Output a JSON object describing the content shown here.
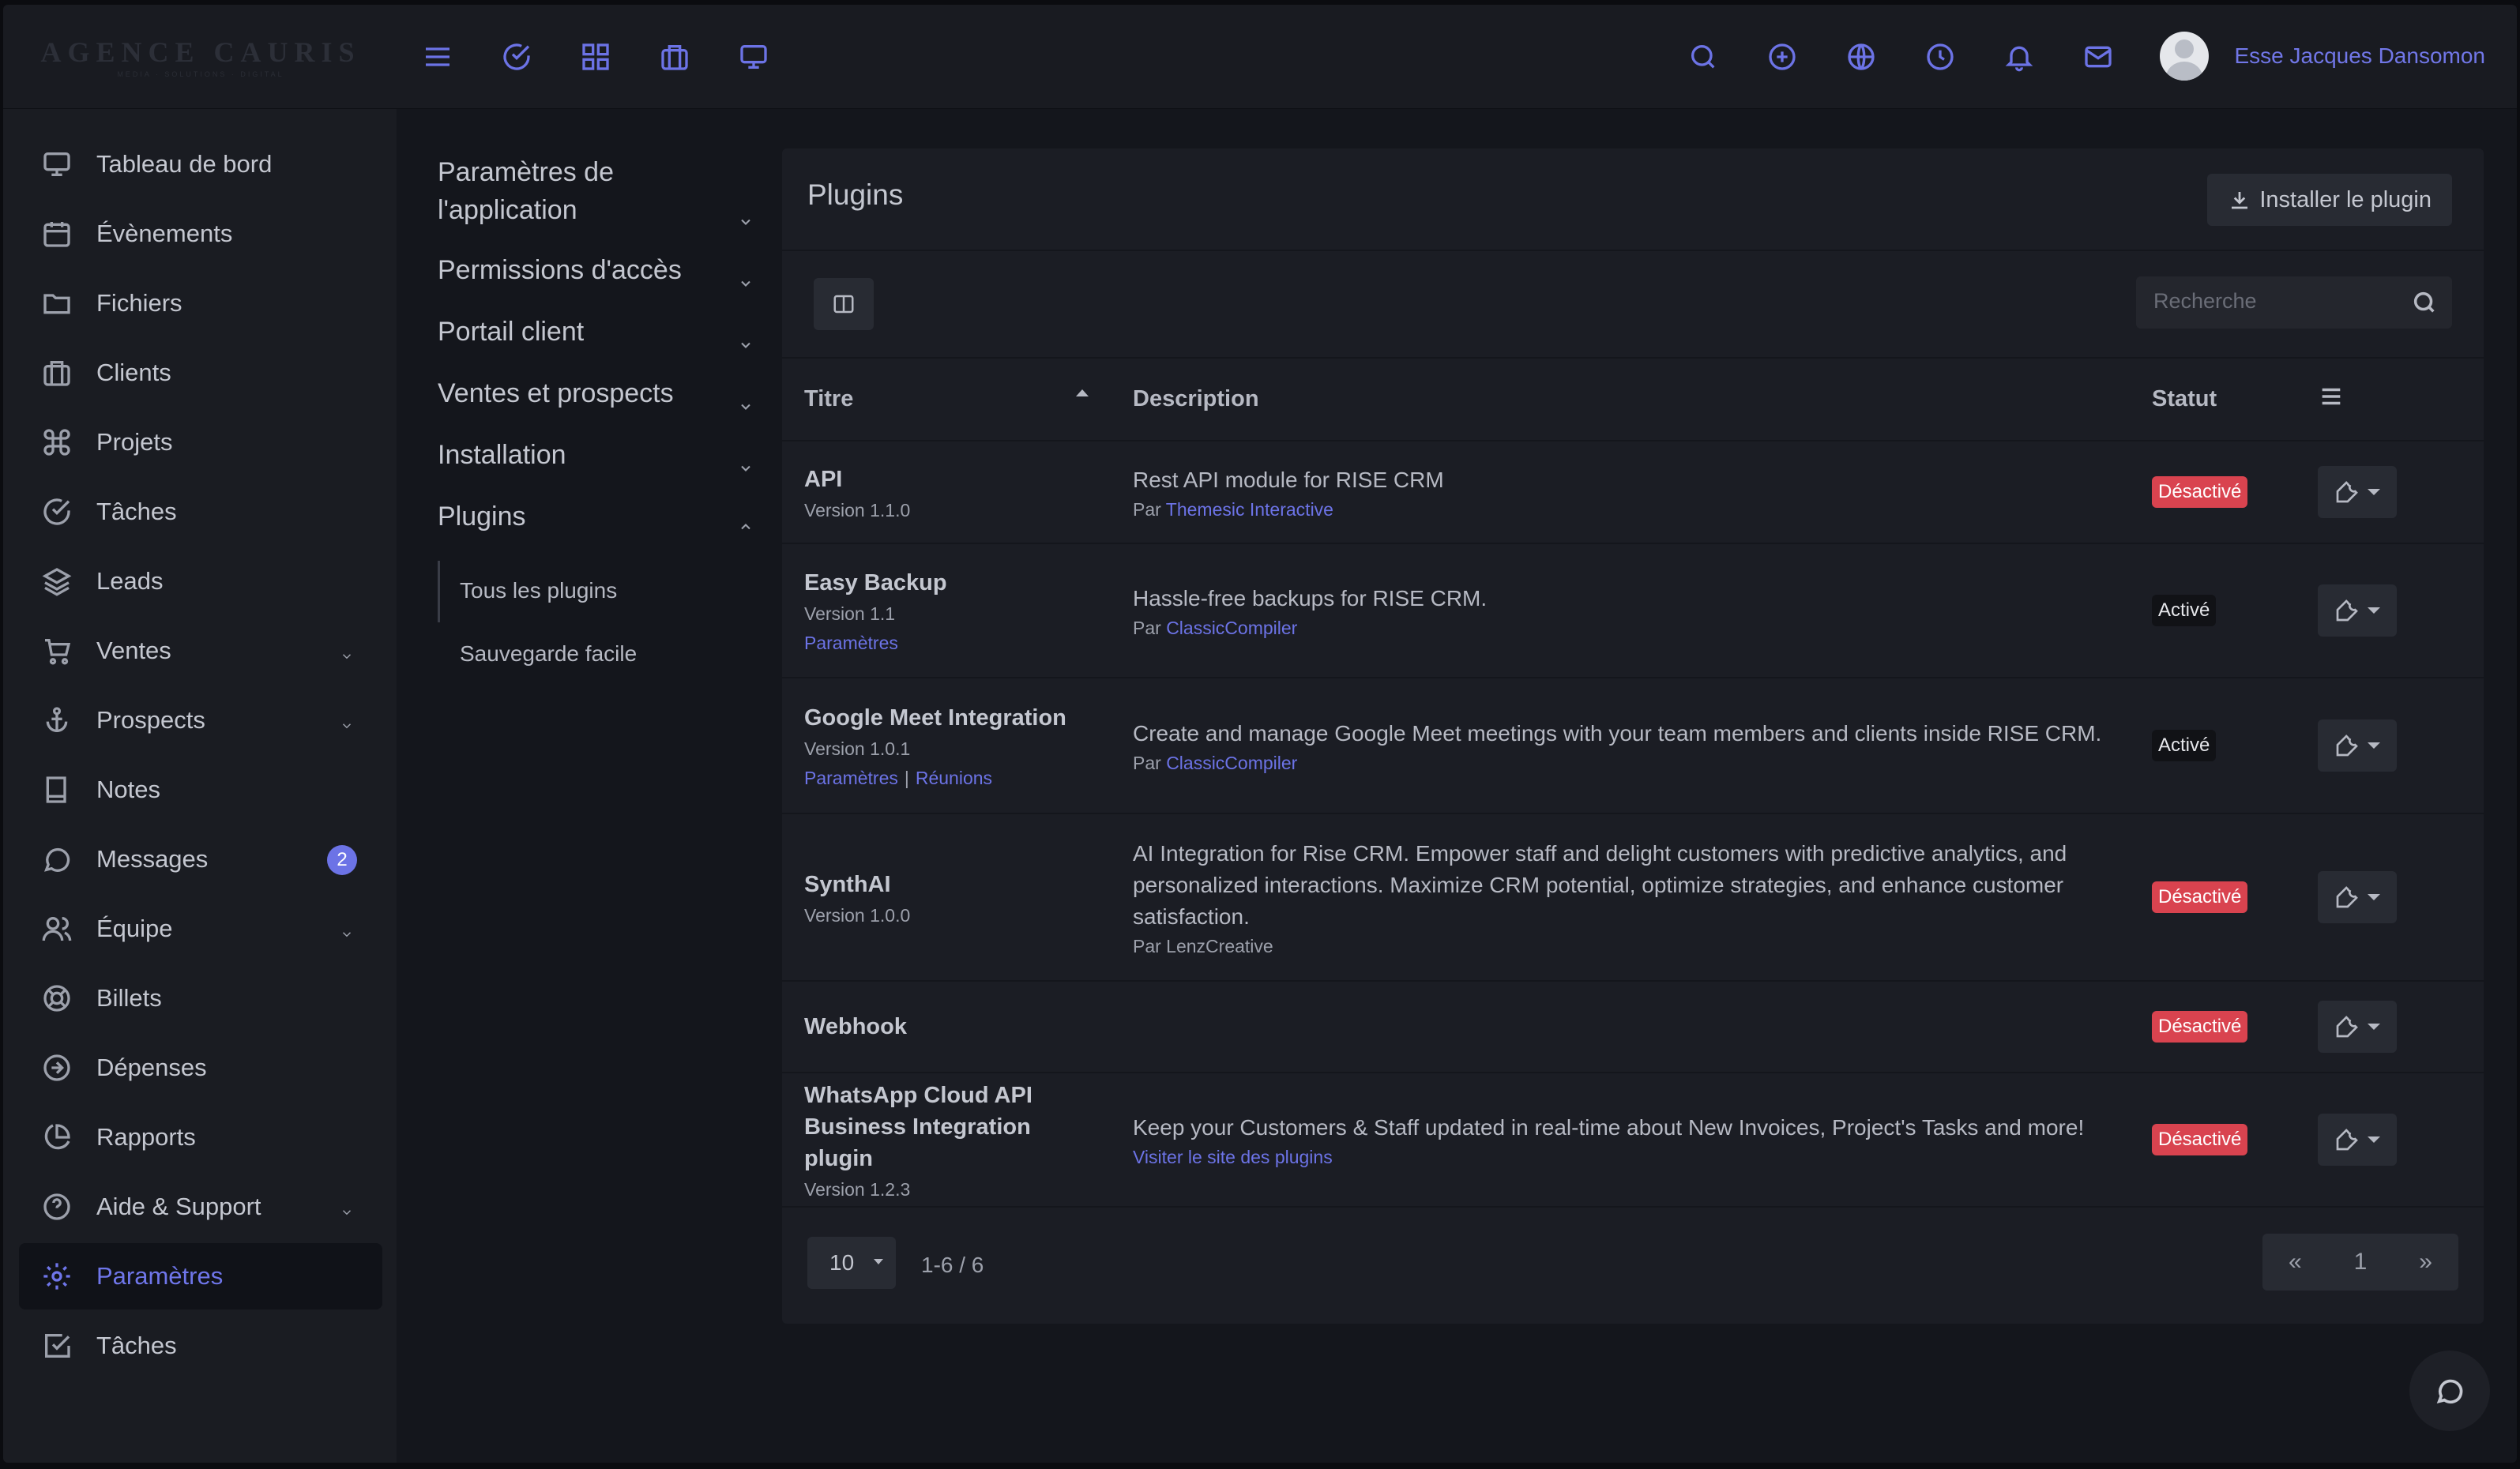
{
  "brand": {
    "name": "AGENCE CAURIS",
    "tagline": "MEDIA · SOLUTIONS · DIGITAL"
  },
  "topbar": {
    "left_icons": [
      "menu-icon",
      "check-circle-icon",
      "grid-icon",
      "briefcase-icon",
      "monitor-icon"
    ],
    "right_icons": [
      "search-icon",
      "plus-circle-icon",
      "globe-icon",
      "clock-icon",
      "bell-icon",
      "mail-icon"
    ],
    "user_name": "Esse Jacques Dansomon"
  },
  "sidebar": {
    "items": [
      {
        "label": "Tableau de bord",
        "icon": "monitor-icon"
      },
      {
        "label": "Évènements",
        "icon": "calendar-icon"
      },
      {
        "label": "Fichiers",
        "icon": "folder-icon"
      },
      {
        "label": "Clients",
        "icon": "briefcase-icon"
      },
      {
        "label": "Projets",
        "icon": "command-icon"
      },
      {
        "label": "Tâches",
        "icon": "check-circle-icon"
      },
      {
        "label": "Leads",
        "icon": "layers-icon"
      },
      {
        "label": "Ventes",
        "icon": "cart-icon",
        "expandable": true
      },
      {
        "label": "Prospects",
        "icon": "anchor-icon",
        "expandable": true
      },
      {
        "label": "Notes",
        "icon": "book-icon"
      },
      {
        "label": "Messages",
        "icon": "message-icon",
        "badge": "2"
      },
      {
        "label": "Équipe",
        "icon": "users-icon",
        "expandable": true
      },
      {
        "label": "Billets",
        "icon": "lifebuoy-icon"
      },
      {
        "label": "Dépenses",
        "icon": "arrow-circle-icon"
      },
      {
        "label": "Rapports",
        "icon": "pie-chart-icon"
      },
      {
        "label": "Aide & Support",
        "icon": "help-circle-icon",
        "expandable": true
      },
      {
        "label": "Paramètres",
        "icon": "gear-icon",
        "active": true
      },
      {
        "label": "Tâches",
        "icon": "check-square-icon"
      }
    ]
  },
  "settings_menu": {
    "items": [
      {
        "label_line1": "Paramètres de",
        "label_line2": "l'application"
      },
      {
        "label": "Permissions d'accès"
      },
      {
        "label": "Portail client"
      },
      {
        "label": "Ventes et prospects"
      },
      {
        "label": "Installation"
      },
      {
        "label": "Plugins",
        "expanded": true
      }
    ],
    "plugin_children": [
      "Tous les plugins",
      "Sauvegarde facile"
    ]
  },
  "panel": {
    "title": "Plugins",
    "install_label": "Installer le plugin",
    "search_placeholder": "Recherche",
    "columns": {
      "title": "Titre",
      "description": "Description",
      "status": "Statut"
    }
  },
  "plugins": [
    {
      "name": "API",
      "version": "Version 1.1.0",
      "desc": "Rest API module for RISE CRM",
      "by_prefix": "Par",
      "author": "Themesic Interactive",
      "status": "Désactivé"
    },
    {
      "name": "Easy Backup",
      "version": "Version 1.1",
      "links": [
        "Paramètres"
      ],
      "desc": "Hassle-free backups for RISE CRM.",
      "by_prefix": "Par",
      "author": "ClassicCompiler",
      "status": "Activé"
    },
    {
      "name": "Google Meet Integration",
      "version": "Version 1.0.1",
      "links": [
        "Paramètres",
        "Réunions"
      ],
      "desc": "Create and manage Google Meet meetings with your team members and clients inside RISE CRM.",
      "by_prefix": "Par",
      "author": "ClassicCompiler",
      "status": "Activé"
    },
    {
      "name": "SynthAI",
      "version": "Version 1.0.0",
      "desc_lines": [
        "AI Integration for Rise CRM. Empower staff and delight customers with predictive analytics, and",
        "personalized interactions. Maximize CRM potential, optimize strategies, and enhance customer",
        "satisfaction."
      ],
      "by_text": "Par LenzCreative",
      "status": "Désactivé"
    },
    {
      "name": "Webhook",
      "status": "Désactivé"
    },
    {
      "name_line1": "WhatsApp Cloud API",
      "name_line2": "Business Integration plugin",
      "version": "Version 1.2.3",
      "desc": "Keep your Customers & Staff updated in real-time about New Invoices, Project's Tasks and more!",
      "link": "Visiter le site des plugins",
      "status": "Désactivé"
    }
  ],
  "pagination": {
    "page_size": "10",
    "info": "1-6 / 6",
    "first": "«",
    "current": "1",
    "last": "»"
  },
  "colors": {
    "accent": "#6c73e6",
    "danger": "#d9434f",
    "panel": "#1b1d24",
    "sidebar": "#1a1c22"
  }
}
